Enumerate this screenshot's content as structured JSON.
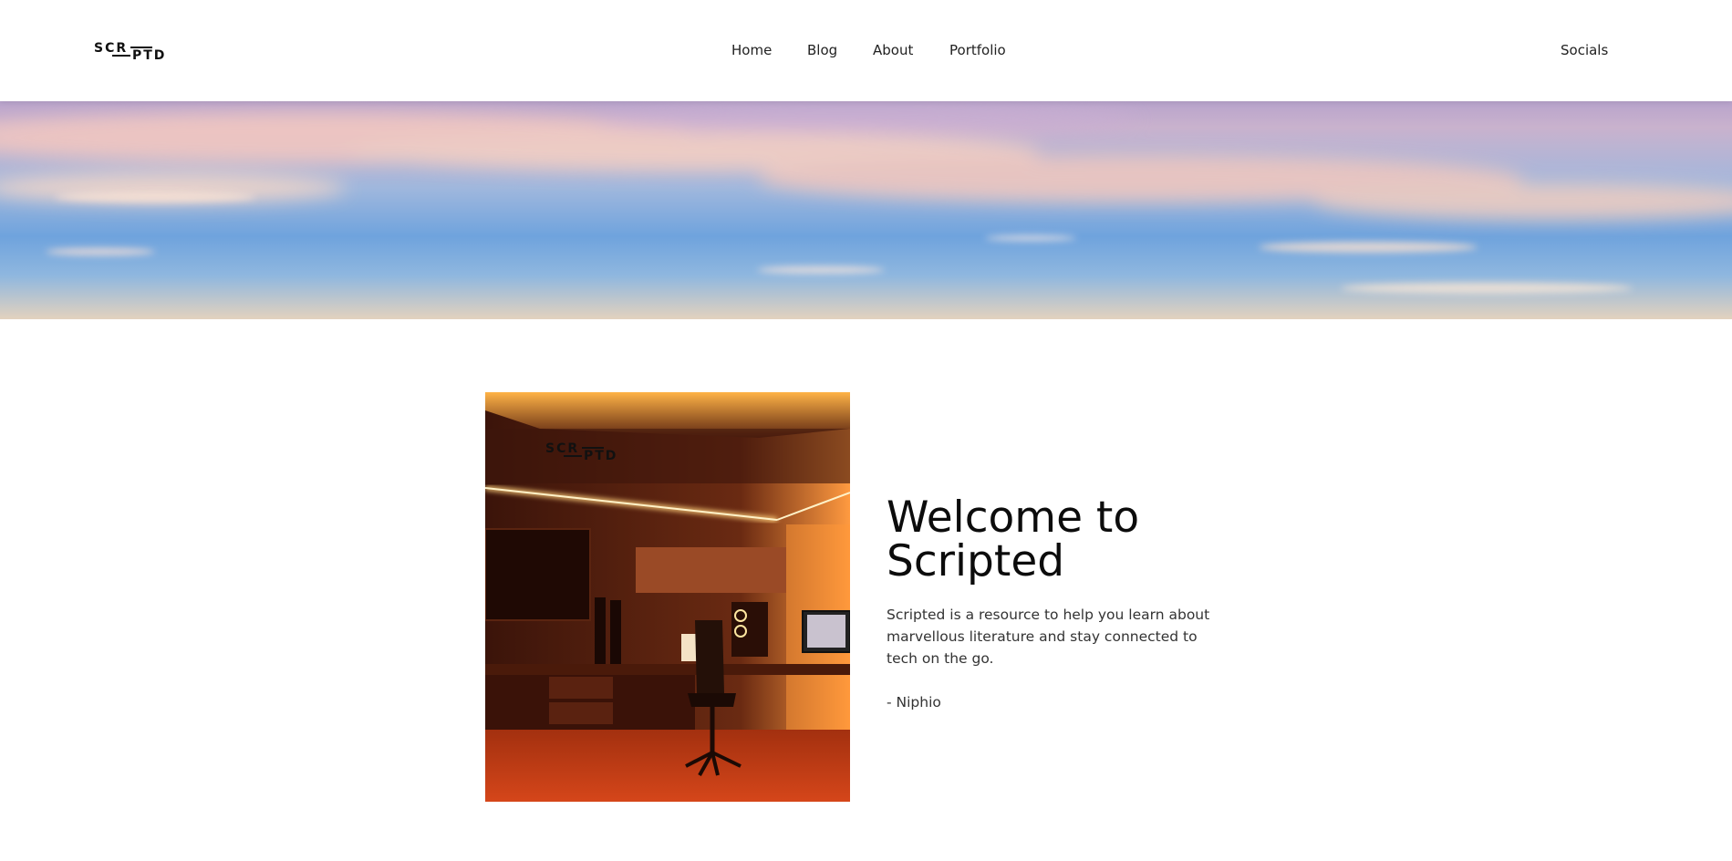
{
  "brand": {
    "logo_top": "SCR",
    "logo_bottom": "PTD"
  },
  "nav": {
    "items": [
      {
        "label": "Home"
      },
      {
        "label": "Blog"
      },
      {
        "label": "About"
      },
      {
        "label": "Portfolio"
      }
    ],
    "socials_label": "Socials"
  },
  "hero": {
    "image": "sunset-sky-clouds"
  },
  "welcome": {
    "image": "gaming-room-orange-led",
    "title": "Welcome to Scripted",
    "description": "Scripted is a resource to help you learn about marvellous literature and stay connected to tech on the go.",
    "signature": "- Niphio"
  },
  "colors": {
    "text": "#111111",
    "header_bg": "#ffffff",
    "room_glow": "#ff8a2a"
  }
}
